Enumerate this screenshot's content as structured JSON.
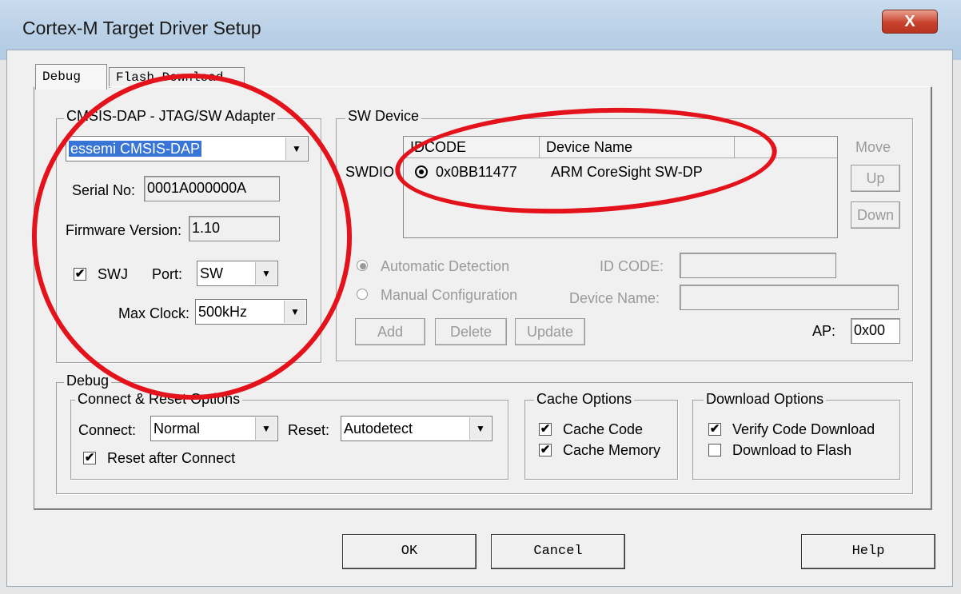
{
  "window": {
    "title": "Cortex-M Target Driver Setup",
    "close_glyph": "X"
  },
  "tabs": [
    {
      "label": "Debug"
    },
    {
      "label": "Flash Download"
    }
  ],
  "adapter": {
    "group_title": "CMSIS-DAP - JTAG/SW Adapter",
    "selected": "essemi CMSIS-DAP",
    "serial_label": "Serial No:",
    "serial_value": "0001A000000A",
    "firmware_label": "Firmware Version:",
    "firmware_value": "1.10",
    "swj_label": "SWJ",
    "swj_checked": true,
    "port_label": "Port:",
    "port_value": "SW",
    "maxclock_label": "Max Clock:",
    "maxclock_value": "500kHz"
  },
  "sw_device": {
    "group_title": "SW Device",
    "side_label": "SWDIO",
    "columns": [
      "IDCODE",
      "Device Name"
    ],
    "rows": [
      {
        "idcode": "0x0BB11477",
        "device_name": "ARM CoreSight SW-DP"
      }
    ],
    "move_label": "Move",
    "up_label": "Up",
    "down_label": "Down",
    "auto_detect_label": "Automatic Detection",
    "manual_config_label": "Manual Configuration",
    "id_code_label": "ID CODE:",
    "device_name_label": "Device Name:",
    "add_label": "Add",
    "delete_label": "Delete",
    "update_label": "Update",
    "ap_label": "AP:",
    "ap_value": "0x00"
  },
  "debug": {
    "group_title": "Debug",
    "connect_reset": {
      "group_title": "Connect & Reset Options",
      "connect_label": "Connect:",
      "connect_value": "Normal",
      "reset_label": "Reset:",
      "reset_value": "Autodetect",
      "reset_after_connect_label": "Reset after Connect",
      "reset_after_connect_checked": true
    },
    "cache": {
      "group_title": "Cache Options",
      "cache_code_label": "Cache Code",
      "cache_code_checked": true,
      "cache_memory_label": "Cache Memory",
      "cache_memory_checked": true
    },
    "download": {
      "group_title": "Download Options",
      "verify_label": "Verify Code Download",
      "verify_checked": true,
      "flash_label": "Download to Flash",
      "flash_checked": false
    }
  },
  "footer": {
    "ok_label": "OK",
    "cancel_label": "Cancel",
    "help_label": "Help"
  },
  "annotation_color": "#e4121b"
}
